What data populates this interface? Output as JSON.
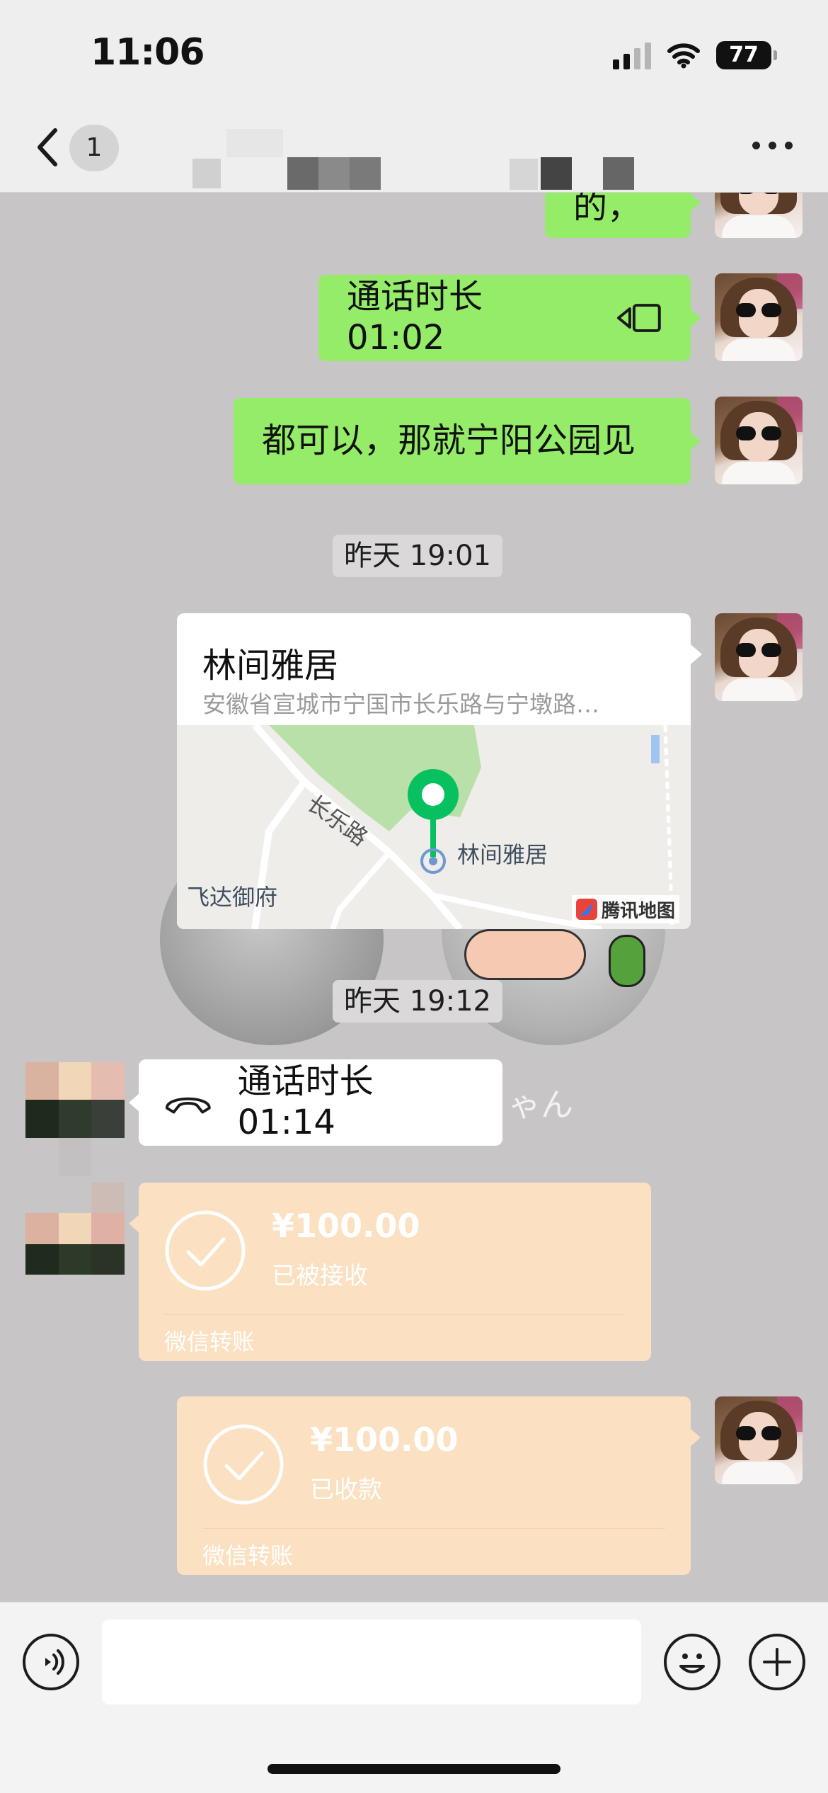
{
  "status_bar": {
    "time": "11:06",
    "battery": "77"
  },
  "nav": {
    "back_count": "1"
  },
  "messages": {
    "partial_text": "好的，",
    "call_out_text": "通话时长 01:02",
    "meet_text": "都可以，那就宁阳公园见",
    "time_1": "昨天 19:01",
    "location": {
      "title": "林间雅居",
      "address": "安徽省宣城市宁国市长乐路与宁墩路…",
      "map_road": "长乐路",
      "map_poi": "林间雅居",
      "map_poi_2": "飞达御府",
      "map_brand": "腾讯地图"
    },
    "time_2": "昨天 19:12",
    "call_in_text": "通话时长 01:14",
    "kana_text": "ゃん",
    "transfer_received": {
      "amount": "¥100.00",
      "state": "已被接收",
      "brand": "微信转账"
    },
    "transfer_collected": {
      "amount": "¥100.00",
      "state": "已收款",
      "brand": "微信转账"
    }
  },
  "colors": {
    "chat_bg": "#c8c5c6",
    "bubble_green": "#95ec69",
    "transfer_bg": "#fbe0c1",
    "map_pin": "#07c160"
  },
  "icons": [
    "back-chevron-icon",
    "more-icon",
    "video-call-icon",
    "phone-hangup-icon",
    "check-icon",
    "voice-icon",
    "emoji-icon",
    "plus-icon",
    "map-pin-icon",
    "tencent-map-icon"
  ]
}
